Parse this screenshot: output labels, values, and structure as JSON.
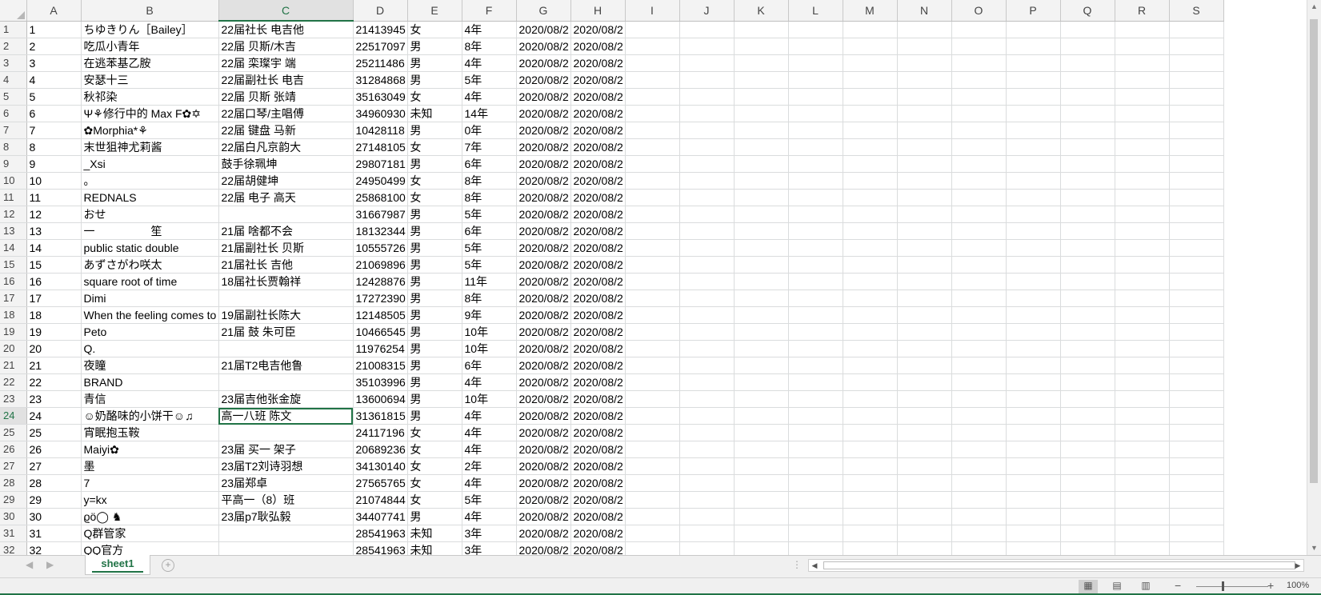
{
  "columns": [
    "A",
    "B",
    "C",
    "D",
    "E",
    "F",
    "G",
    "H",
    "I",
    "J",
    "K",
    "L",
    "M",
    "N",
    "O",
    "P",
    "Q",
    "R",
    "S"
  ],
  "rows": [
    [
      "1",
      "ちゆきりん［Bailey］",
      "22届社长 电吉他",
      "21413945",
      "女",
      "4年",
      "2020/08/2",
      "2020/08/2"
    ],
    [
      "2",
      "吃瓜小青年",
      "22届 贝斯/木吉",
      "22517097",
      "男",
      "8年",
      "2020/08/2",
      "2020/08/2"
    ],
    [
      "3",
      "在逃苯基乙胺",
      "22届 栾璨宇 端",
      "25211486",
      "男",
      "4年",
      "2020/08/2",
      "2020/08/2"
    ],
    [
      "4",
      "安瑟十三",
      "22届副社长 电吉",
      "31284868",
      "男",
      "5年",
      "2020/08/2",
      "2020/08/2"
    ],
    [
      "5",
      "秋祁染",
      "22届 贝斯 张靖",
      "35163049",
      "女",
      "4年",
      "2020/08/2",
      "2020/08/2"
    ],
    [
      "6",
      "Ψ⚘修行中的 Max F✿✡",
      "22届口琴/主唱傅",
      "34960930",
      "未知",
      "14年",
      "2020/08/2",
      "2020/08/2"
    ],
    [
      "7",
      "✿Morphia*⚘",
      "22届 键盘 马新",
      "10428118",
      "男",
      "0年",
      "2020/08/2",
      "2020/08/2"
    ],
    [
      "8",
      "末世狙神尤莉酱",
      "22届白凡京韵大",
      "27148105",
      "女",
      "7年",
      "2020/08/2",
      "2020/08/2"
    ],
    [
      "9",
      "_Xsi",
      "鼓手徐珮坤",
      "29807181",
      "男",
      "6年",
      "2020/08/2",
      "2020/08/2"
    ],
    [
      "10",
      "。",
      "22届胡健坤",
      "24950499",
      "女",
      "8年",
      "2020/08/2",
      "2020/08/2"
    ],
    [
      "11",
      "REDNALS",
      "22届 电子 高天",
      "25868100",
      "女",
      "8年",
      "2020/08/2",
      "2020/08/2"
    ],
    [
      "12",
      "おせ",
      "",
      "31667987",
      "男",
      "5年",
      "2020/08/2",
      "2020/08/2"
    ],
    [
      "13",
      "一　　　　　笙",
      "21届 啥都不会",
      "18132344",
      "男",
      "6年",
      "2020/08/2",
      "2020/08/2"
    ],
    [
      "14",
      "public static double",
      "21届副社长 贝斯",
      "10555726",
      "男",
      "5年",
      "2020/08/2",
      "2020/08/2"
    ],
    [
      "15",
      "あずさがわ咲太",
      "21届社长 吉他",
      "21069896",
      "男",
      "5年",
      "2020/08/2",
      "2020/08/2"
    ],
    [
      "16",
      "square root of time",
      "18届社长贾翰祥",
      "12428876",
      "男",
      "11年",
      "2020/08/2",
      "2020/08/2"
    ],
    [
      "17",
      "Dimi",
      "",
      "17272390",
      "男",
      "8年",
      "2020/08/2",
      "2020/08/2"
    ],
    [
      "18",
      "When the feeling comes to",
      "19届副社长陈大",
      "12148505",
      "男",
      "9年",
      "2020/08/2",
      "2020/08/2"
    ],
    [
      "19",
      "Peto",
      "21届 鼓 朱可臣",
      "10466545",
      "男",
      "10年",
      "2020/08/2",
      "2020/08/2"
    ],
    [
      "20",
      "Q.",
      "",
      "11976254",
      "男",
      "10年",
      "2020/08/2",
      "2020/08/2"
    ],
    [
      "21",
      "夜瞳",
      "21届T2电吉他鲁",
      "21008315",
      "男",
      "6年",
      "2020/08/2",
      "2020/08/2"
    ],
    [
      "22",
      "BRAND",
      "",
      "35103996",
      "男",
      "4年",
      "2020/08/2",
      "2020/08/2"
    ],
    [
      "23",
      "青信",
      "23届吉他张金旋",
      "13600694",
      "男",
      "10年",
      "2020/08/2",
      "2020/08/2"
    ],
    [
      "24",
      "☺奶酪味的小饼干☺♫",
      "高一八班 陈文",
      "31361815",
      "男",
      "4年",
      "2020/08/2",
      "2020/08/2"
    ],
    [
      "25",
      "宵眠抱玉鞍",
      "",
      "24117196",
      "女",
      "4年",
      "2020/08/2",
      "2020/08/2"
    ],
    [
      "26",
      "Maiyi✿",
      "23届 买一 架子",
      "20689236",
      "女",
      "4年",
      "2020/08/2",
      "2020/08/2"
    ],
    [
      "27",
      "墨",
      "23届T2刘诗羽想",
      "34130140",
      "女",
      "2年",
      "2020/08/2",
      "2020/08/2"
    ],
    [
      "28",
      "7",
      "23届郑卓",
      "27565765",
      "女",
      "4年",
      "2020/08/2",
      "2020/08/2"
    ],
    [
      "29",
      "y=kx",
      "平高一（8）班",
      "21074844",
      "女",
      "5年",
      "2020/08/2",
      "2020/08/2"
    ],
    [
      "30",
      "ϱö◯ ♞",
      "23届p7耿弘毅",
      "34407741",
      "男",
      "4年",
      "2020/08/2",
      "2020/08/2"
    ],
    [
      "31",
      "Q群管家",
      "",
      "28541963",
      "未知",
      "3年",
      "2020/08/2",
      "2020/08/2"
    ],
    [
      "32",
      "QQ官方",
      "",
      "28541963",
      "未知",
      "3年",
      "2020/08/2",
      "2020/08/2"
    ]
  ],
  "selection": {
    "row": "24",
    "column": "C"
  },
  "sheet_tab": "sheet1",
  "zoom": "100%",
  "icons": [
    "add-sheet-icon",
    "scroll-left-icon",
    "scroll-right-icon",
    "normal-view-icon",
    "page-layout-icon",
    "page-break-icon",
    "zoom-minus-icon",
    "zoom-plus-icon",
    "select-all-corner-icon"
  ],
  "accent_color": "#217346"
}
